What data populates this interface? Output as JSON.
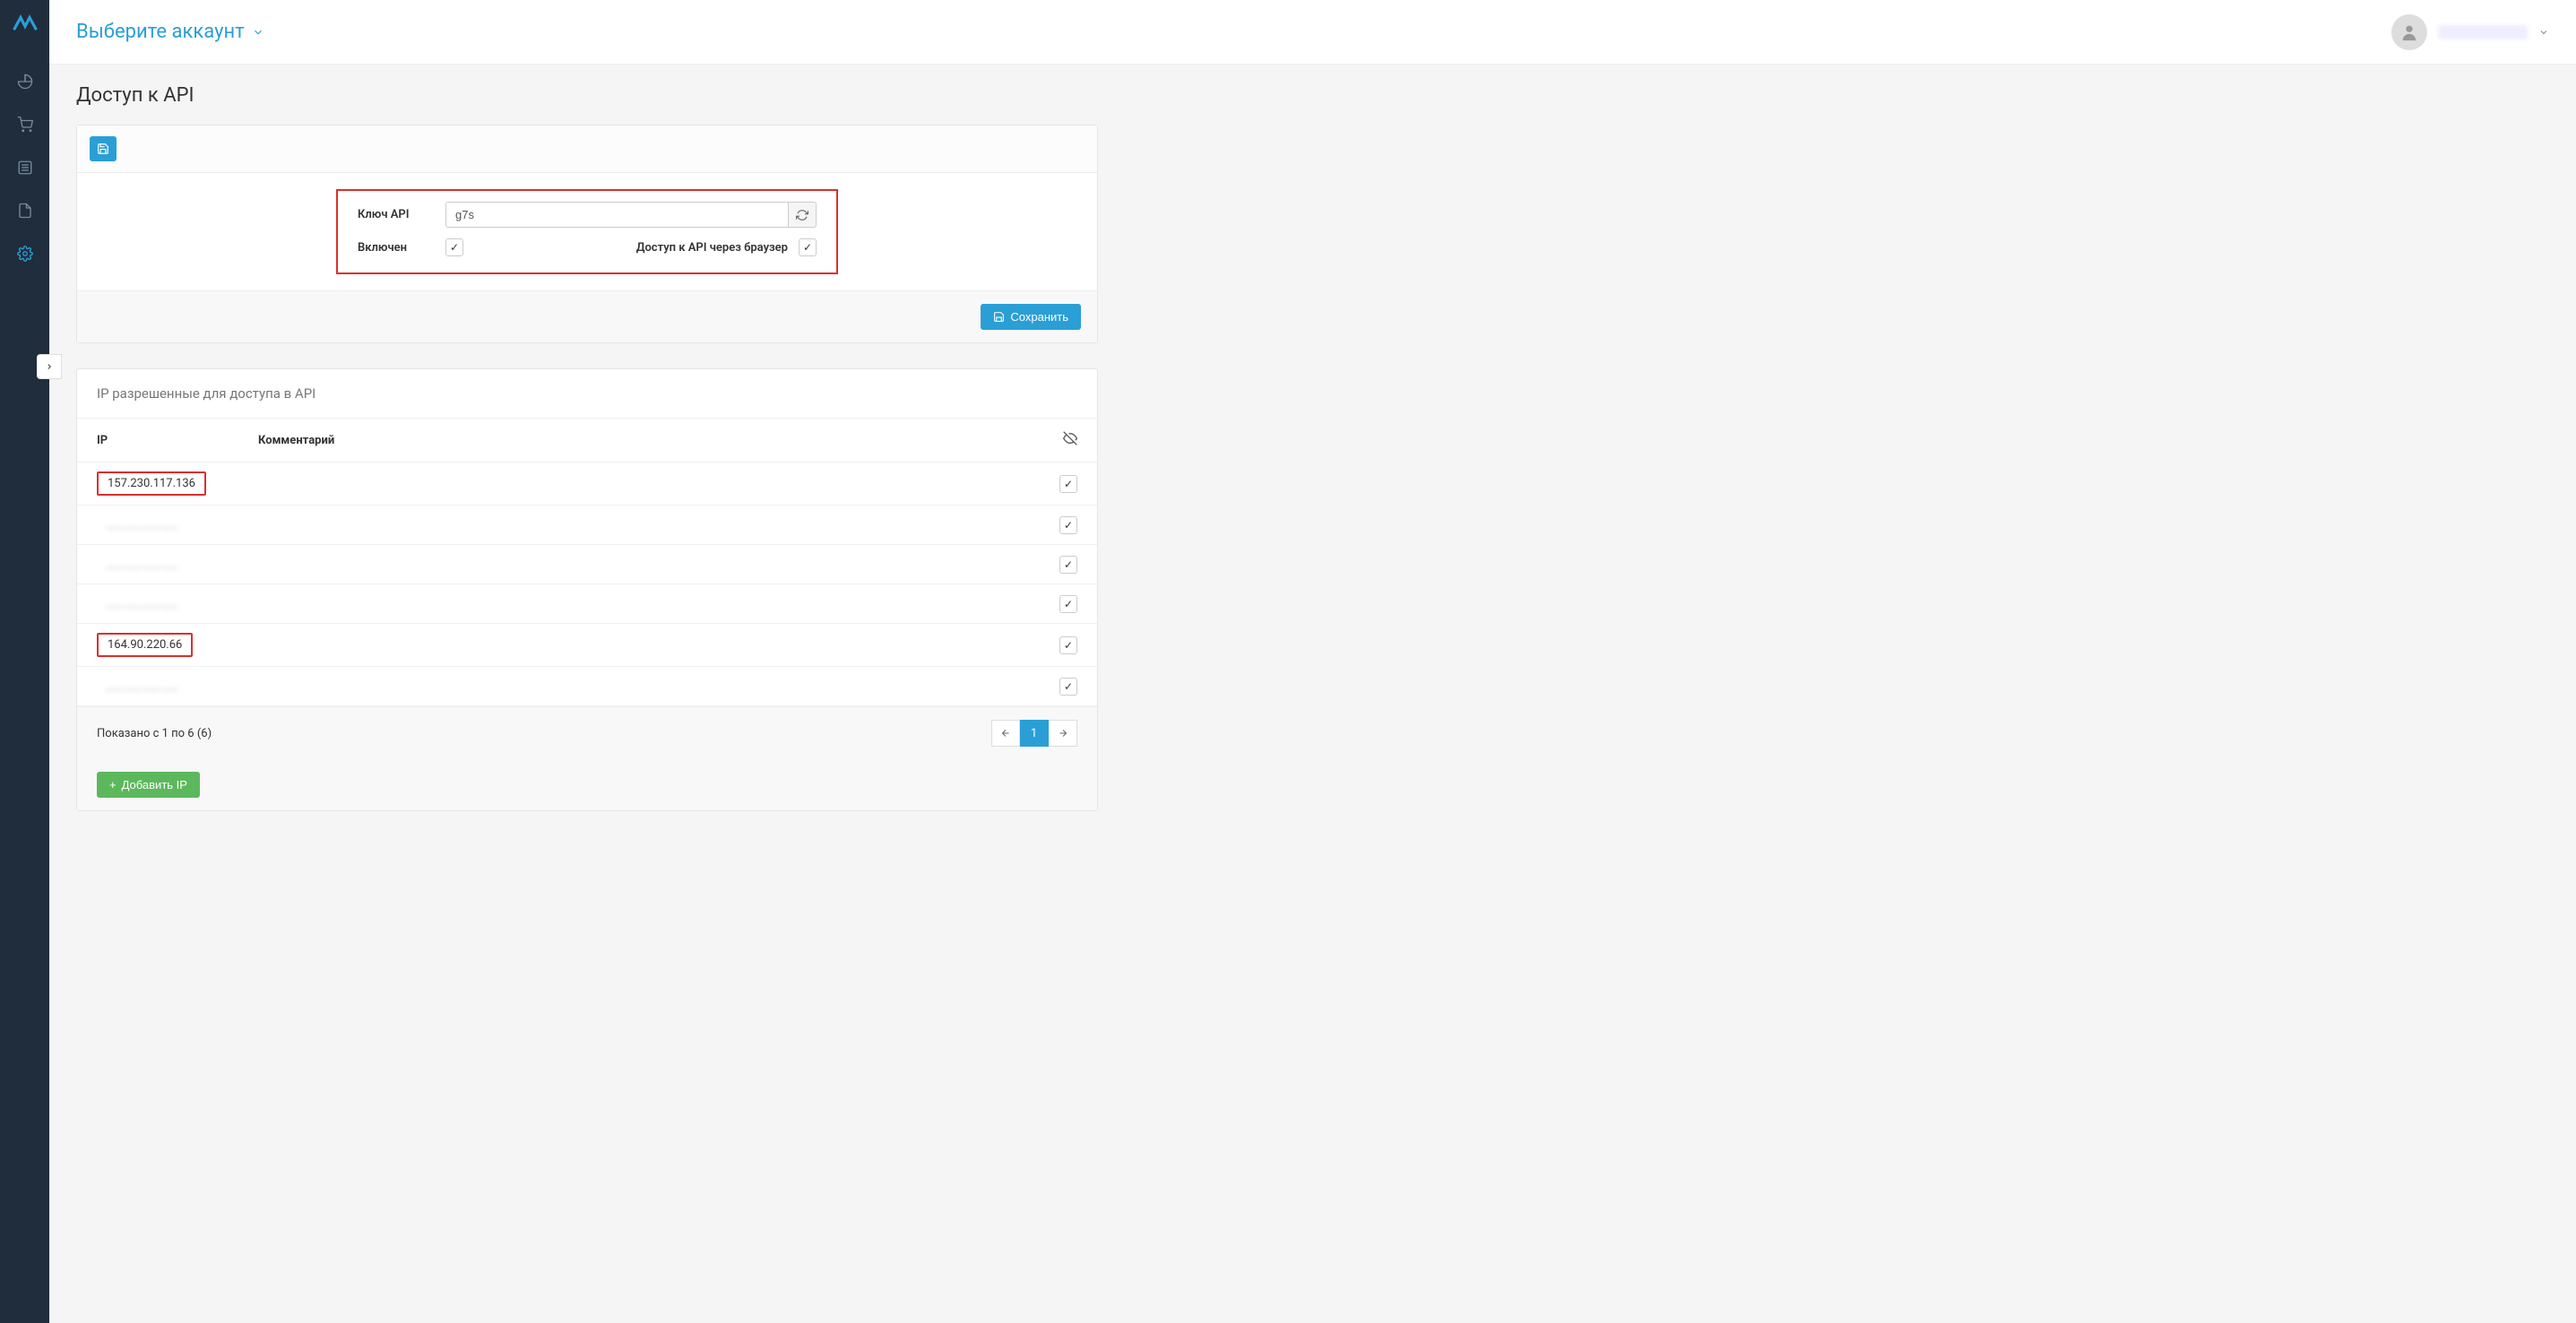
{
  "header": {
    "account_selector": "Выберите аккаунт"
  },
  "page": {
    "title": "Доступ к API"
  },
  "api_form": {
    "key_label": "Ключ API",
    "key_value": "g7s",
    "enabled_label": "Включен",
    "enabled_checked": true,
    "browser_access_label": "Доступ к API через браузер",
    "browser_access_checked": true,
    "save_button": "Сохранить"
  },
  "ip_section": {
    "title": "IP разрешенные для доступа в API",
    "columns": {
      "ip": "IP",
      "comment": "Комментарий"
    },
    "rows": [
      {
        "ip": "157.230.117.136",
        "highlight": true,
        "blur": false,
        "checked": true
      },
      {
        "ip": "___.___.___.___",
        "highlight": false,
        "blur": true,
        "checked": true
      },
      {
        "ip": "___.___.___.___",
        "highlight": false,
        "blur": true,
        "checked": true
      },
      {
        "ip": "___.___.___.___",
        "highlight": false,
        "blur": true,
        "checked": true
      },
      {
        "ip": "164.90.220.66",
        "highlight": true,
        "blur": false,
        "checked": true
      },
      {
        "ip": "___.___.___.___",
        "highlight": false,
        "blur": true,
        "checked": true
      }
    ],
    "pagination_summary": "Показано с 1 по 6 (6)",
    "page_current": "1",
    "add_ip_button": "Добавить IP"
  }
}
